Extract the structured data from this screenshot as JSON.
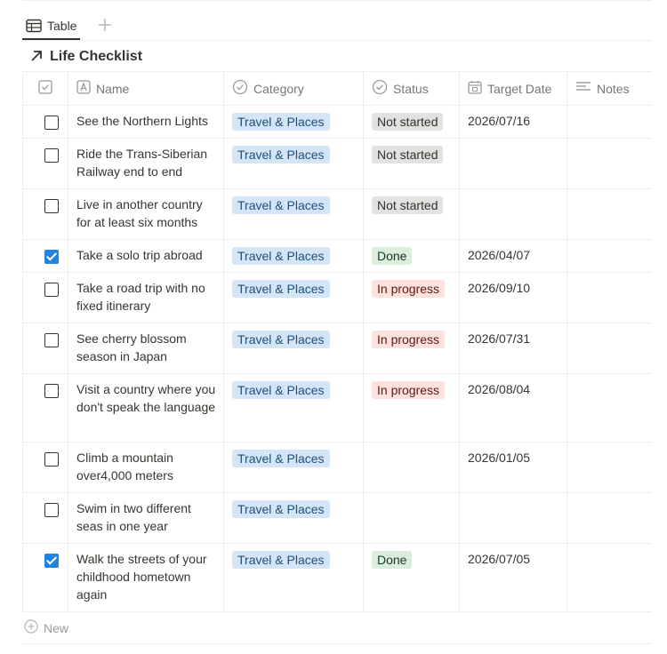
{
  "view": {
    "tab_label": "Table",
    "add_icon": "plus-icon",
    "table_icon": "table-icon"
  },
  "database": {
    "title": "Life Checklist",
    "title_icon": "arrow-up-right-icon"
  },
  "columns": [
    {
      "label": "",
      "icon": "checkbox-icon"
    },
    {
      "label": "Name",
      "icon": "text-icon"
    },
    {
      "label": "Category",
      "icon": "select-icon"
    },
    {
      "label": "Status",
      "icon": "status-icon"
    },
    {
      "label": "Target Date",
      "icon": "calendar-icon"
    },
    {
      "label": "Notes",
      "icon": "lines-icon"
    }
  ],
  "rows": [
    {
      "done": false,
      "name": "See the Northern Lights",
      "category": "Travel & Places",
      "status": "Not started",
      "date": "2026/07/16",
      "notes": ""
    },
    {
      "done": false,
      "name": "Ride the Trans-Siberian Railway end to end",
      "category": "Travel & Places",
      "status": "Not started",
      "date": "",
      "notes": ""
    },
    {
      "done": false,
      "name": "Live in another country for at least six months",
      "category": "Travel & Places",
      "status": "Not started",
      "date": "",
      "notes": ""
    },
    {
      "done": true,
      "name": "Take a solo trip abroad",
      "category": "Travel & Places",
      "status": "Done",
      "date": "2026/04/07",
      "notes": ""
    },
    {
      "done": false,
      "name": "Take a road trip with no fixed itinerary",
      "category": "Travel & Places",
      "status": "In progress",
      "date": "2026/09/10",
      "notes": ""
    },
    {
      "done": false,
      "name": "See cherry blossom season in Japan",
      "category": "Travel & Places",
      "status": "In progress",
      "date": "2026/07/31",
      "notes": ""
    },
    {
      "done": false,
      "name": "Visit a country where you don't speak the language",
      "category": "Travel & Places",
      "status": "In progress",
      "date": "2026/08/04",
      "notes": ""
    },
    {
      "done": false,
      "name": "Climb a mountain over4,000 meters",
      "category": "Travel & Places",
      "status": "",
      "date": "2026/01/05",
      "notes": ""
    },
    {
      "done": false,
      "name": "Swim in two different seas in one year",
      "category": "Travel & Places",
      "status": "",
      "date": "",
      "notes": ""
    },
    {
      "done": true,
      "name": "Walk the streets of your childhood hometown again",
      "category": "Travel & Places",
      "status": "Done",
      "date": "2026/07/05",
      "notes": ""
    }
  ],
  "new_row": {
    "label": "New",
    "icon": "plus-circle-icon"
  },
  "colors": {
    "checkbox_checked": "#2383e2",
    "tag_category_bg": "#d3e5f7",
    "status_not_started_bg": "#e3e2e0",
    "status_done_bg": "#dbeddb",
    "status_in_progress_bg": "#ffe2dd"
  }
}
